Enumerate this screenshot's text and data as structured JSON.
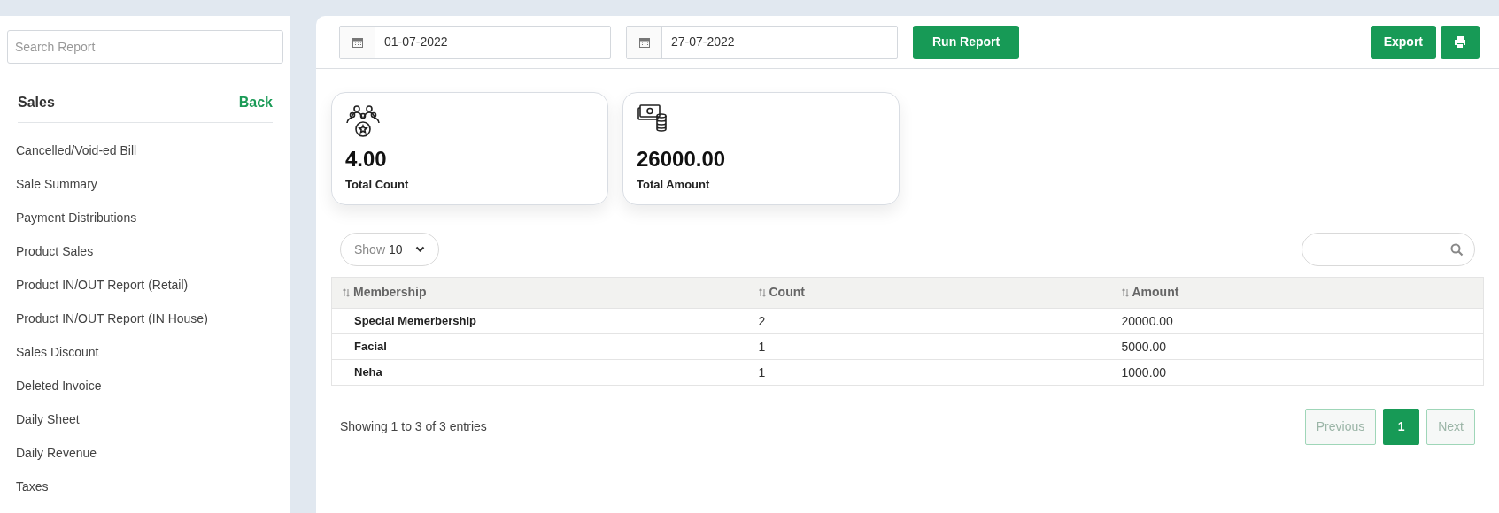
{
  "sidebar": {
    "search": {
      "placeholder": "Search Report"
    },
    "section_title": "Sales",
    "back_link": "Back",
    "items": [
      {
        "label": "Cancelled/Void-ed Bill"
      },
      {
        "label": "Sale Summary"
      },
      {
        "label": "Payment Distributions"
      },
      {
        "label": "Product Sales"
      },
      {
        "label": "Product IN/OUT Report (Retail)"
      },
      {
        "label": "Product IN/OUT Report (IN House)"
      },
      {
        "label": "Sales Discount"
      },
      {
        "label": "Deleted Invoice"
      },
      {
        "label": "Daily Sheet"
      },
      {
        "label": "Daily Revenue"
      },
      {
        "label": "Taxes"
      }
    ]
  },
  "toolbar": {
    "date_from": "01-07-2022",
    "date_to": "27-07-2022",
    "run_button": "Run Report",
    "export_button": "Export"
  },
  "stats": [
    {
      "kind": "count",
      "value": "4.00",
      "label": "Total Count"
    },
    {
      "kind": "amount",
      "value": "26000.00",
      "label": "Total Amount"
    }
  ],
  "table_controls": {
    "show_label": "Show",
    "show_value": "10"
  },
  "table": {
    "columns": [
      "Membership",
      "Count",
      "Amount"
    ],
    "rows": [
      [
        "Special Memerbership",
        "2",
        "20000.00"
      ],
      [
        "Facial",
        "1",
        "5000.00"
      ],
      [
        "Neha",
        "1",
        "1000.00"
      ]
    ]
  },
  "footer": {
    "info": "Showing 1 to 3 of 3 entries",
    "previous": {
      "label": "Previous",
      "disabled": true
    },
    "pages": [
      {
        "label": "1",
        "selected": true
      }
    ],
    "next": {
      "label": "Next",
      "disabled": true
    }
  }
}
